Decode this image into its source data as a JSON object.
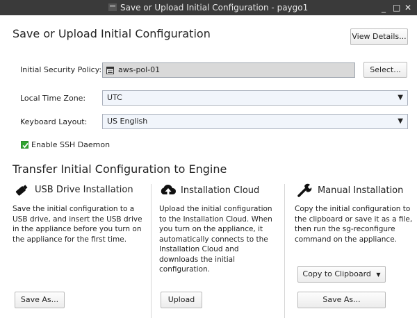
{
  "window": {
    "title": "Save or Upload Initial Configuration - paygo1",
    "minimize_glyph": "_",
    "maximize_glyph": "□",
    "close_glyph": "✕"
  },
  "header": {
    "title": "Save or Upload Initial Configuration",
    "view_details_label": "View Details..."
  },
  "form": {
    "security_policy": {
      "label": "Initial Security Policy:",
      "value": "aws-pol-01",
      "select_label": "Select..."
    },
    "time_zone": {
      "label": "Local Time Zone:",
      "value": "UTC"
    },
    "keyboard": {
      "label": "Keyboard Layout:",
      "value": "US English"
    },
    "ssh": {
      "label": "Enable SSH Daemon",
      "checked": true
    }
  },
  "transfer": {
    "title": "Transfer Initial Configuration to Engine",
    "usb": {
      "title": "USB Drive Installation",
      "lines": [
        "Save the initial configuration to a",
        "USB drive, and insert the USB drive",
        "in the appliance before you turn on",
        "the appliance for the first time."
      ],
      "save_as_label": "Save As..."
    },
    "cloud": {
      "title": "Installation Cloud",
      "lines": [
        "Upload the initial configuration",
        "to the Installation Cloud. When",
        "you turn on the appliance, it",
        "automatically connects to the",
        "Installation Cloud and",
        "downloads the initial",
        "configuration."
      ],
      "upload_label": "Upload"
    },
    "manual": {
      "title": "Manual Installation",
      "lines": [
        "Copy the initial configuration to",
        "the clipboard or save it as a file,",
        "then run the sg-reconfigure",
        "command on the appliance."
      ],
      "copy_label": "Copy to Clipboard",
      "save_as_label": "Save As..."
    }
  },
  "colors": {
    "titlebar": "#3a3a3a",
    "check": "#2ea32e",
    "readonly_field": "#d9d9d9"
  }
}
